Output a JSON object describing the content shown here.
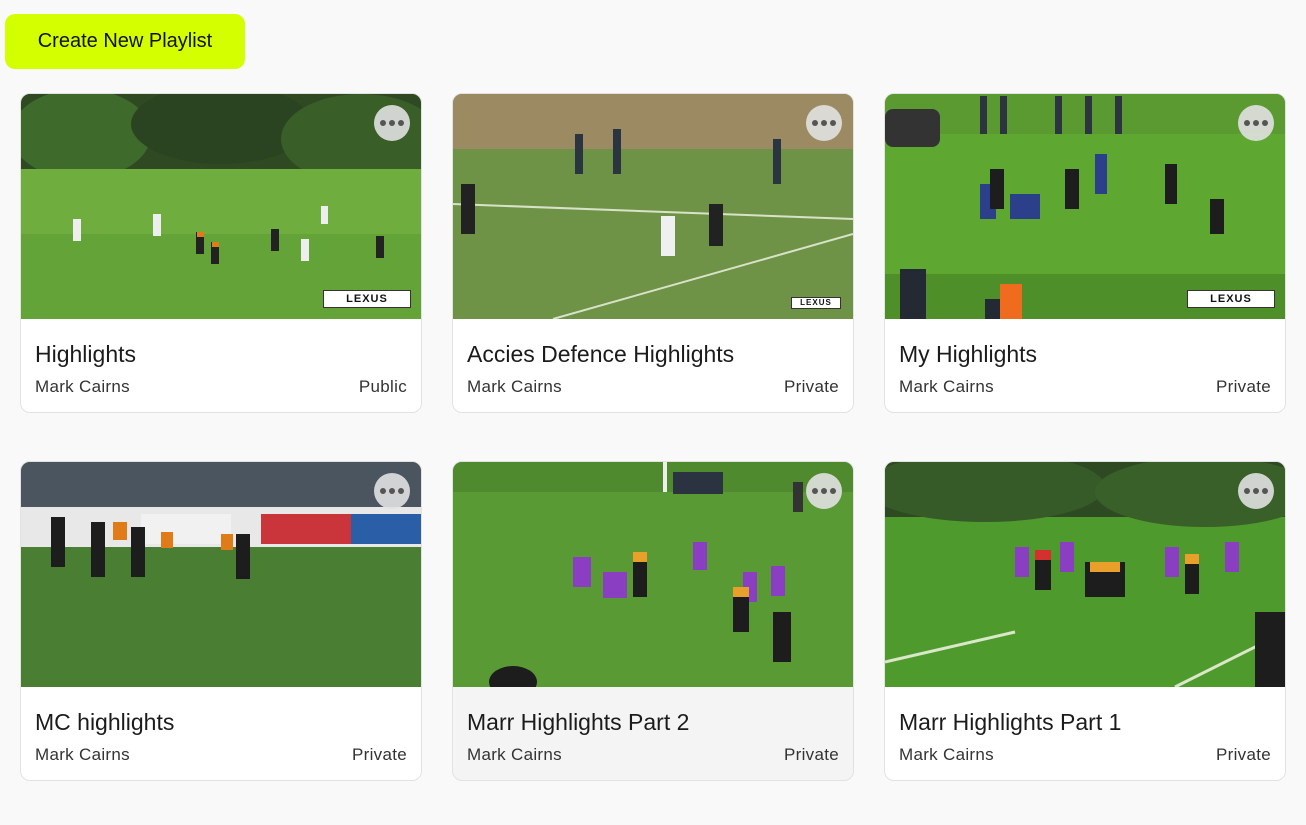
{
  "toolbar": {
    "create_label": "Create New Playlist"
  },
  "cards": [
    {
      "title": "Highlights",
      "owner": "Mark Cairns",
      "visibility": "Public",
      "thumbnail": "rugby-match-grass-trees",
      "watermark": "LEXUS"
    },
    {
      "title": "Accies Defence Highlights",
      "owner": "Mark Cairns",
      "visibility": "Private",
      "thumbnail": "rugby-break-through-defence",
      "watermark": "LEXUS"
    },
    {
      "title": "My Highlights",
      "owner": "Mark Cairns",
      "visibility": "Private",
      "thumbnail": "rugby-ruck-spectators",
      "watermark": "LEXUS"
    },
    {
      "title": "MC highlights",
      "owner": "Mark Cairns",
      "visibility": "Private",
      "thumbnail": "rugby-tackle-near-stand"
    },
    {
      "title": "Marr Highlights Part 2",
      "owner": "Mark Cairns",
      "visibility": "Private",
      "thumbnail": "rugby-purple-vs-amber"
    },
    {
      "title": "Marr Highlights Part 1",
      "owner": "Mark Cairns",
      "visibility": "Private",
      "thumbnail": "rugby-maul-purple-amber"
    }
  ],
  "icons": {
    "more": "more-horizontal-icon"
  },
  "colors": {
    "accent": "#d4ff00",
    "card_bg": "#ffffff",
    "page_bg": "#f9f9f9"
  }
}
